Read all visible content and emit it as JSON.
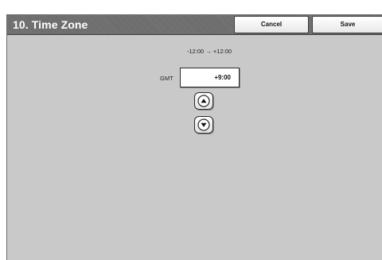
{
  "header": {
    "title": "10. Time Zone",
    "cancel_label": "Cancel",
    "save_label": "Save"
  },
  "time_zone": {
    "range_text": "-12:00 → +12:00",
    "gmt_label": "GMT",
    "value": "+9:00",
    "increment_icon": "arrow-up-icon",
    "decrement_icon": "arrow-down-icon"
  },
  "colors": {
    "panel_background": "#c9c9c9",
    "header_background": "#6b6b6b",
    "title_text": "#ffffff"
  }
}
